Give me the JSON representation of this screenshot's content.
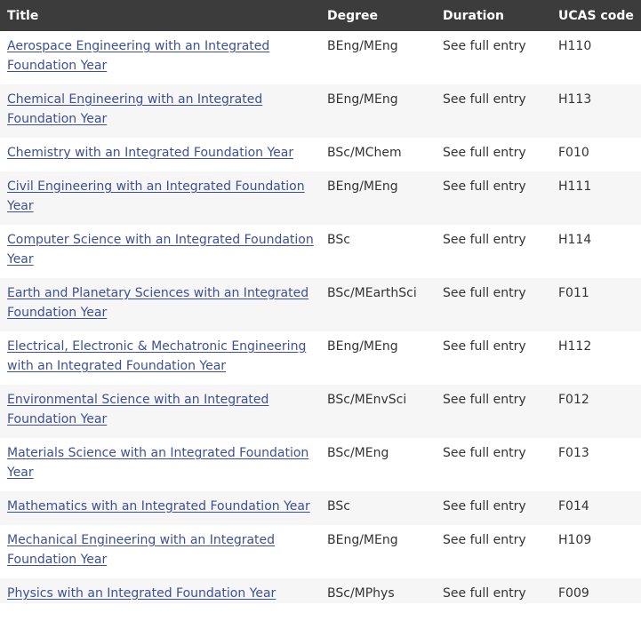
{
  "table": {
    "headers": {
      "title": "Title",
      "degree": "Degree",
      "duration": "Duration",
      "ucas": "UCAS code"
    },
    "rows": [
      {
        "title": "Aerospace Engineering with an Integrated Foundation Year",
        "degree": "BEng/MEng",
        "duration": "See full entry",
        "ucas": "H110"
      },
      {
        "title": "Chemical Engineering with an Integrated Foundation Year",
        "degree": "BEng/MEng",
        "duration": "See full entry",
        "ucas": "H113"
      },
      {
        "title": "Chemistry with an Integrated Foundation Year",
        "degree": "BSc/MChem",
        "duration": "See full entry",
        "ucas": "F010"
      },
      {
        "title": "Civil Engineering with an Integrated Foundation Year",
        "degree": "BEng/MEng",
        "duration": "See full entry",
        "ucas": "H111"
      },
      {
        "title": "Computer Science with an Integrated Foundation Year",
        "degree": "BSc",
        "duration": "See full entry",
        "ucas": "H114"
      },
      {
        "title": "Earth and Planetary Sciences with an Integrated Foundation Year",
        "degree": "BSc/MEarthSci",
        "duration": "See full entry",
        "ucas": "F011"
      },
      {
        "title": "Electrical, Electronic & Mechatronic Engineering with an Integrated Foundation Year",
        "degree": "BEng/MEng",
        "duration": "See full entry",
        "ucas": "H112"
      },
      {
        "title": "Environmental Science with an Integrated Foundation Year",
        "degree": "BSc/MEnvSci",
        "duration": "See full entry",
        "ucas": "F012"
      },
      {
        "title": "Materials Science with an Integrated Foundation Year",
        "degree": "BSc/MEng",
        "duration": "See full entry",
        "ucas": "F013"
      },
      {
        "title": "Mathematics with an Integrated Foundation Year",
        "degree": "BSc",
        "duration": "See full entry",
        "ucas": "F014"
      },
      {
        "title": "Mechanical Engineering with an Integrated Foundation Year",
        "degree": "BEng/MEng",
        "duration": "See full entry",
        "ucas": "H109"
      },
      {
        "title": "Physics with an Integrated Foundation Year",
        "degree": "BSc/MPhys",
        "duration": "See full entry",
        "ucas": "F009"
      }
    ]
  }
}
